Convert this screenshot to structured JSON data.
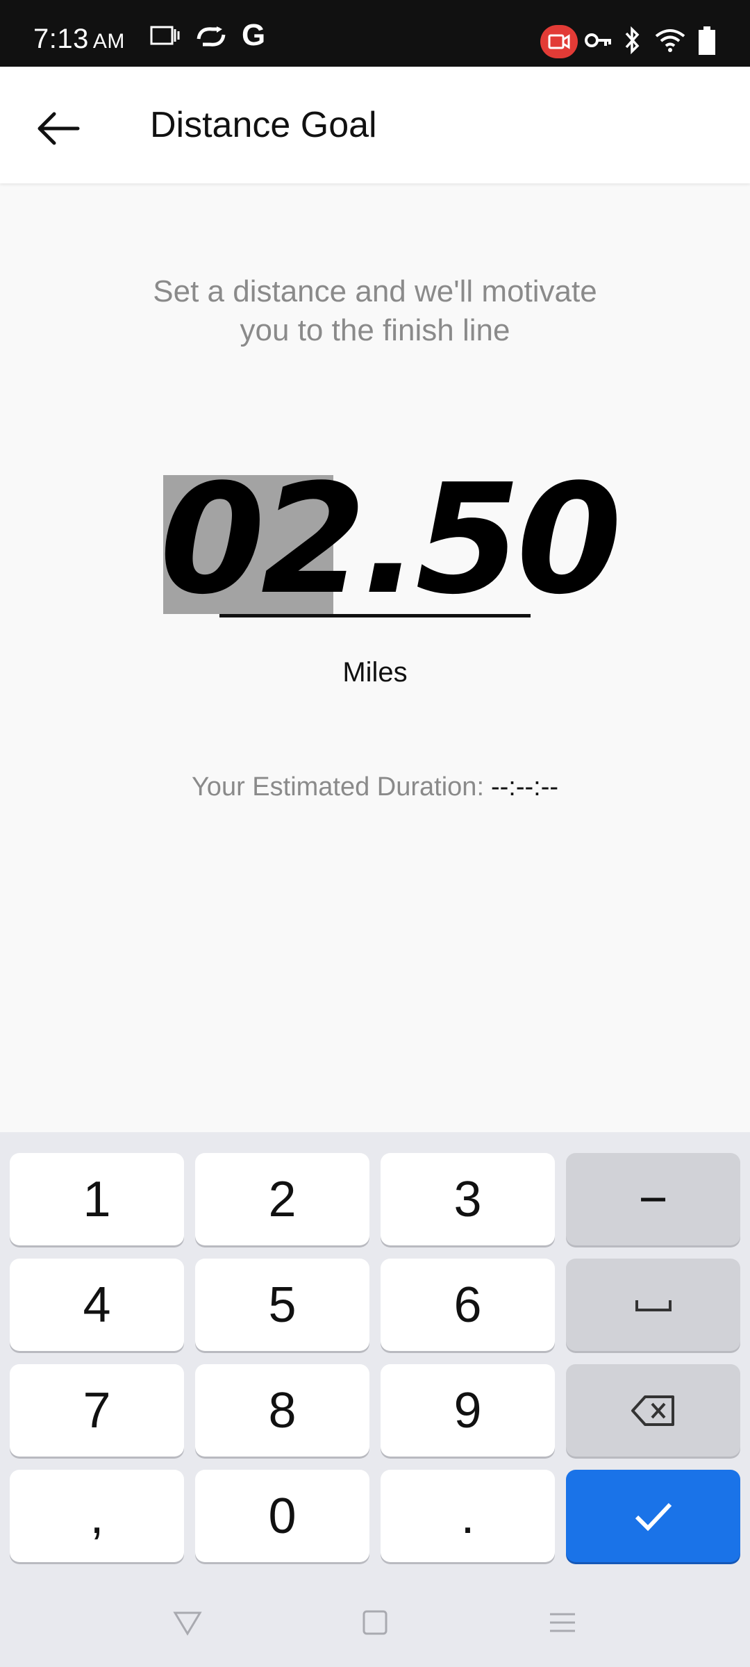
{
  "status_bar": {
    "time": "7:13",
    "ampm": "AM",
    "left_icons": [
      "screen-cast-icon",
      "sync-icon",
      "google-g-icon"
    ],
    "right_icons": [
      "screen-record-icon",
      "vpn-key-icon",
      "bluetooth-icon",
      "wifi-icon",
      "battery-icon"
    ],
    "google_letter": "G"
  },
  "app_bar": {
    "title": "Distance Goal",
    "back_icon": "arrow-left-icon"
  },
  "content": {
    "subtitle_line1": "Set a distance and we'll motivate",
    "subtitle_line2": "you to the finish line",
    "distance_value_selected": "02",
    "distance_value_rest": ".50",
    "unit": "Miles",
    "duration_label": "Your Estimated Duration:",
    "duration_value": "--:--:--"
  },
  "keyboard": {
    "rows": [
      [
        "1",
        "2",
        "3",
        "−"
      ],
      [
        "4",
        "5",
        "6",
        "␣"
      ],
      [
        "7",
        "8",
        "9",
        "⌫"
      ],
      [
        ",",
        "0",
        ".",
        "✓"
      ]
    ],
    "accent_color": "#1a73e8"
  },
  "nav_bar": {
    "icons": [
      "back-triangle-icon",
      "home-square-icon",
      "menu-lines-icon"
    ]
  }
}
